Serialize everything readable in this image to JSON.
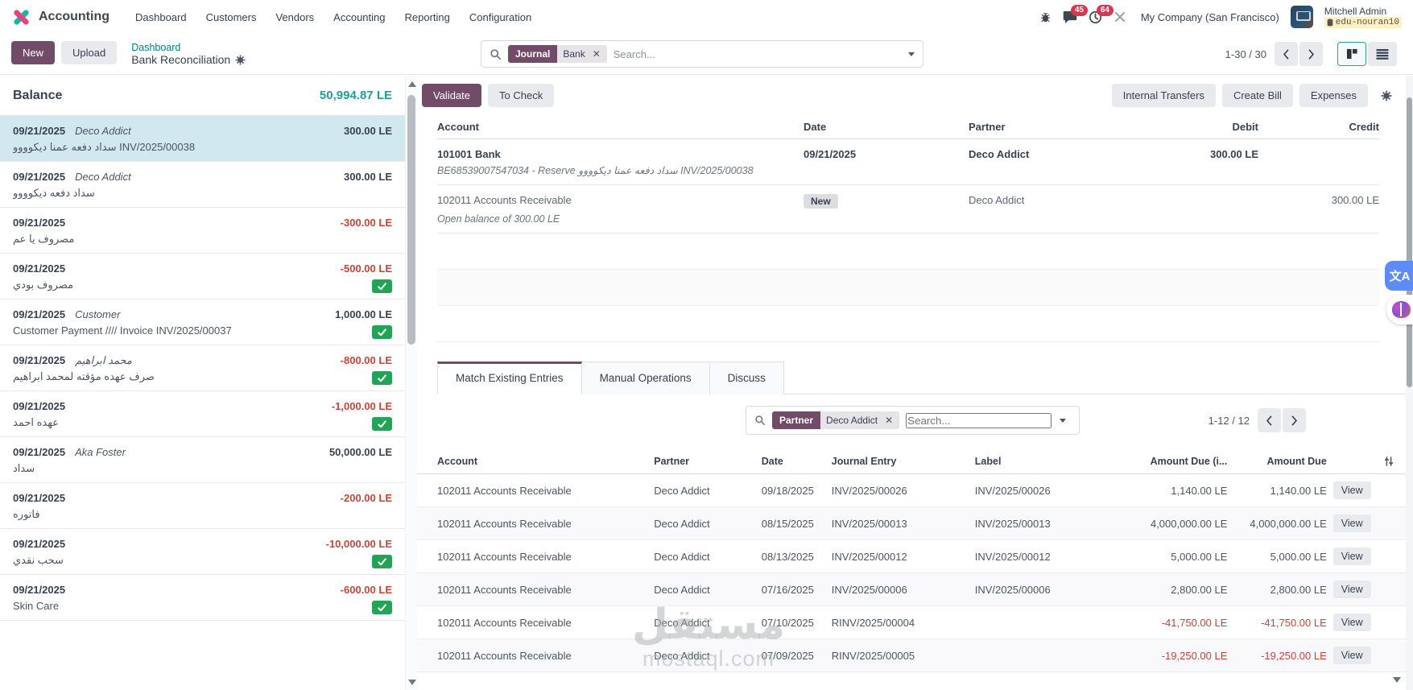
{
  "app": {
    "name": "Accounting"
  },
  "nav": {
    "items": [
      {
        "label": "Dashboard"
      },
      {
        "label": "Customers"
      },
      {
        "label": "Vendors"
      },
      {
        "label": "Accounting"
      },
      {
        "label": "Reporting"
      },
      {
        "label": "Configuration"
      }
    ]
  },
  "topbar": {
    "messages_badge": "45",
    "activities_badge": "64",
    "company": "My Company (San Francisco)",
    "user_name": "Mitchell Admin",
    "database": "edu-nouran10"
  },
  "control": {
    "new_label": "New",
    "upload_label": "Upload",
    "breadcrumb": "Dashboard",
    "title": "Bank Reconciliation",
    "search": {
      "facet_label": "Journal",
      "facet_value": "Bank",
      "placeholder": "Search..."
    },
    "pager": "1-30 / 30"
  },
  "left_panel": {
    "balance_label": "Balance",
    "balance_value": "50,994.87 LE",
    "lines": [
      {
        "date": "09/21/2025",
        "partner": "Deco Addict",
        "amount": "300.00 LE",
        "label": "سداد دفعه عمنا ديكوووو INV/2025/00038"
      },
      {
        "date": "09/21/2025",
        "partner": "Deco Addict",
        "amount": "300.00 LE",
        "label": "سداد دفعه ديكوووو"
      },
      {
        "date": "09/21/2025",
        "partner": "",
        "amount": "-300.00 LE",
        "label": "مصروف يا عم"
      },
      {
        "date": "09/21/2025",
        "partner": "",
        "amount": "-500.00 LE",
        "label": "مصروف بودي"
      },
      {
        "date": "09/21/2025",
        "partner": "Customer",
        "amount": "1,000.00 LE",
        "label": "Customer Payment //// Invoice INV/2025/00037"
      },
      {
        "date": "09/21/2025",
        "partner": "محمد ابراهيم",
        "amount": "-800.00 LE",
        "label": "صرف عهده مؤقته لمحمد ابراهيم"
      },
      {
        "date": "09/21/2025",
        "partner": "",
        "amount": "-1,000.00 LE",
        "label": "عهده احمد"
      },
      {
        "date": "09/21/2025",
        "partner": "Aka Foster",
        "amount": "50,000.00 LE",
        "label": "سداد"
      },
      {
        "date": "09/21/2025",
        "partner": "",
        "amount": "-200.00 LE",
        "label": "فاتوره"
      },
      {
        "date": "09/21/2025",
        "partner": "",
        "amount": "-10,000.00 LE",
        "label": "سحب نقدي"
      },
      {
        "date": "09/21/2025",
        "partner": "",
        "amount": "-600.00 LE",
        "label": "Skin Care"
      }
    ]
  },
  "entry": {
    "validate_label": "Validate",
    "to_check_label": "To Check",
    "actions": [
      {
        "label": "Internal Transfers"
      },
      {
        "label": "Create Bill"
      },
      {
        "label": "Expenses"
      }
    ],
    "headers": {
      "account": "Account",
      "date": "Date",
      "partner": "Partner",
      "debit": "Debit",
      "credit": "Credit"
    },
    "rows": [
      {
        "account": "101001 Bank",
        "note": "BE68539007547034 - Reserve سداد دفعه عمنا ديكوووو INV/2025/00038",
        "date": "09/21/2025",
        "badge": "",
        "partner": "Deco Addict",
        "debit": "300.00 LE",
        "credit": ""
      },
      {
        "account": "102011 Accounts Receivable",
        "note": "Open balance of 300.00 LE",
        "date": "",
        "badge": "New",
        "partner": "Deco Addict",
        "debit": "",
        "credit": "300.00 LE"
      }
    ]
  },
  "tabs": [
    {
      "label": "Match Existing Entries"
    },
    {
      "label": "Manual Operations"
    },
    {
      "label": "Discuss"
    }
  ],
  "match": {
    "search": {
      "facet_label": "Partner",
      "facet_value": "Deco Addict",
      "placeholder": "Search..."
    },
    "pager": "1-12 / 12",
    "headers": [
      "Account",
      "Partner",
      "Date",
      "Journal Entry",
      "Label",
      "Amount Due (i...",
      "Amount Due"
    ],
    "rows": [
      {
        "account": "102011 Accounts Receivable",
        "partner": "Deco Addict",
        "date": "09/18/2025",
        "entry": "INV/2025/00026",
        "label": "INV/2025/00026",
        "due1": "1,140.00 LE",
        "due2": "1,140.00 LE",
        "view": "View"
      },
      {
        "account": "102011 Accounts Receivable",
        "partner": "Deco Addict",
        "date": "08/15/2025",
        "entry": "INV/2025/00013",
        "label": "INV/2025/00013",
        "due1": "4,000,000.00 LE",
        "due2": "4,000,000.00 LE",
        "view": "View"
      },
      {
        "account": "102011 Accounts Receivable",
        "partner": "Deco Addict",
        "date": "08/13/2025",
        "entry": "INV/2025/00012",
        "label": "INV/2025/00012",
        "due1": "5,000.00 LE",
        "due2": "5,000.00 LE",
        "view": "View"
      },
      {
        "account": "102011 Accounts Receivable",
        "partner": "Deco Addict",
        "date": "07/16/2025",
        "entry": "INV/2025/00006",
        "label": "INV/2025/00006",
        "due1": "2,800.00 LE",
        "due2": "2,800.00 LE",
        "view": "View"
      },
      {
        "account": "102011 Accounts Receivable",
        "partner": "Deco Addict",
        "date": "07/10/2025",
        "entry": "RINV/2025/00004",
        "label": "",
        "due1": "-41,750.00 LE",
        "due2": "-41,750.00 LE",
        "view": "View"
      },
      {
        "account": "102011 Accounts Receivable",
        "partner": "Deco Addict",
        "date": "07/09/2025",
        "entry": "RINV/2025/00005",
        "label": "",
        "due1": "-19,250.00 LE",
        "due2": "-19,250.00 LE",
        "view": "View"
      }
    ]
  },
  "watermark": {
    "line1": "مستقل",
    "line2": "mostaql.com"
  }
}
